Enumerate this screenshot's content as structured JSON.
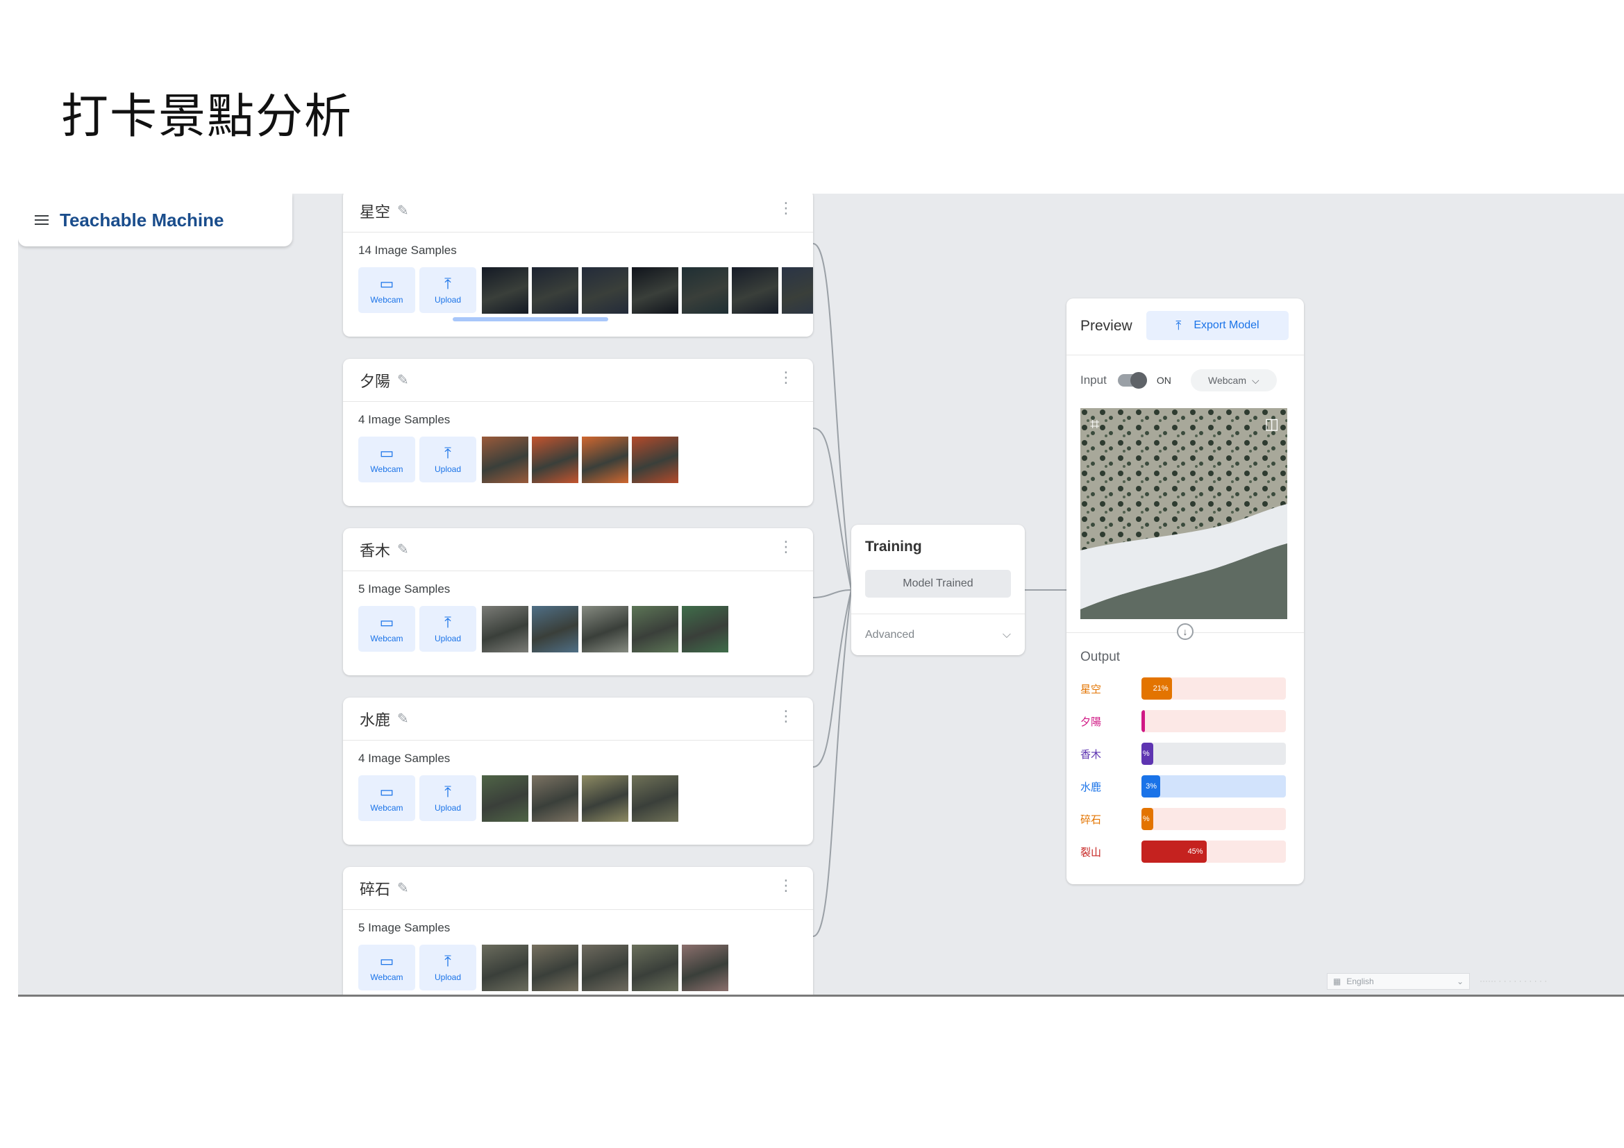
{
  "slide": {
    "title": "打卡景點分析"
  },
  "app": {
    "name": "Teachable Machine"
  },
  "classes": [
    {
      "name": "星空",
      "samples": "14 Image Samples",
      "webcam_label": "Webcam",
      "upload_label": "Upload",
      "thumbs": [
        "#141a25",
        "#1c2331",
        "#232b3a",
        "#10141c",
        "#1f2f34",
        "#161c28",
        "#2a3446"
      ]
    },
    {
      "name": "夕陽",
      "samples": "4 Image Samples",
      "webcam_label": "Webcam",
      "upload_label": "Upload",
      "thumbs": [
        "#9a5a3a",
        "#c4542e",
        "#d0672f",
        "#b44a2a"
      ]
    },
    {
      "name": "香木",
      "samples": "5 Image Samples",
      "webcam_label": "Webcam",
      "upload_label": "Upload",
      "thumbs": [
        "#7a7b76",
        "#4f6f86",
        "#858a80",
        "#5c7556",
        "#3f6d4a"
      ]
    },
    {
      "name": "水鹿",
      "samples": "4 Image Samples",
      "webcam_label": "Webcam",
      "upload_label": "Upload",
      "thumbs": [
        "#4f6446",
        "#7b7262",
        "#8d8a62",
        "#6f7157"
      ]
    },
    {
      "name": "碎石",
      "samples": "5 Image Samples",
      "webcam_label": "Webcam",
      "upload_label": "Upload",
      "thumbs": [
        "#6b6c5d",
        "#76705f",
        "#6e6a5e",
        "#6a6f5b",
        "#8b6f6c"
      ]
    }
  ],
  "training": {
    "title": "Training",
    "button": "Model Trained",
    "advanced": "Advanced"
  },
  "preview": {
    "title": "Preview",
    "export_label": "Export Model",
    "input_label": "Input",
    "toggle_state": "ON",
    "source": "Webcam",
    "output_title": "Output",
    "outputs": [
      {
        "label": "星空",
        "text": "21%",
        "value": 0.21,
        "fill": "#e37400",
        "track": "#fce8e6",
        "label_color": "#e37400"
      },
      {
        "label": "夕陽",
        "text": "",
        "value": 0.015,
        "fill": "#d01884",
        "track": "#fce8e6",
        "label_color": "#d01884"
      },
      {
        "label": "香木",
        "text": "%",
        "value": 0.08,
        "fill": "#5e35b1",
        "track": "#e8eaed",
        "label_color": "#5e35b1"
      },
      {
        "label": "水鹿",
        "text": "3%",
        "value": 0.13,
        "fill": "#1a73e8",
        "track": "#d2e3fc",
        "label_color": "#1a73e8"
      },
      {
        "label": "碎石",
        "text": "%",
        "value": 0.08,
        "fill": "#e37400",
        "track": "#fce8e6",
        "label_color": "#e37400"
      },
      {
        "label": "裂山",
        "text": "45%",
        "value": 0.45,
        "fill": "#c5221f",
        "track": "#fce8e6",
        "label_color": "#c5221f"
      }
    ]
  },
  "footer": {
    "language": "English"
  }
}
